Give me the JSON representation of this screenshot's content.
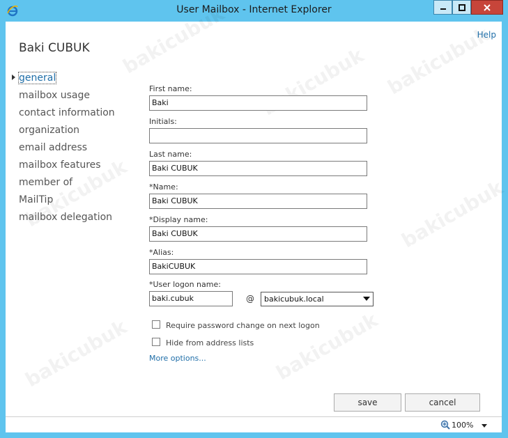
{
  "window": {
    "title": "User Mailbox - Internet Explorer",
    "minimize_icon": "minimize-icon",
    "maximize_icon": "maximize-icon",
    "close_icon": "close-icon"
  },
  "header": {
    "help": "Help",
    "user_name": "Baki CUBUK"
  },
  "nav": {
    "items": [
      {
        "label": "general",
        "active": true
      },
      {
        "label": "mailbox usage"
      },
      {
        "label": "contact information"
      },
      {
        "label": "organization"
      },
      {
        "label": "email address"
      },
      {
        "label": "mailbox features"
      },
      {
        "label": "member of"
      },
      {
        "label": "MailTip"
      },
      {
        "label": "mailbox delegation"
      }
    ]
  },
  "form": {
    "first_name": {
      "label": "First name:",
      "value": "Baki"
    },
    "initials": {
      "label": "Initials:",
      "value": ""
    },
    "last_name": {
      "label": "Last name:",
      "value": "Baki CUBUK"
    },
    "name": {
      "label": "*Name:",
      "value": "Baki CUBUK"
    },
    "display_name": {
      "label": "*Display name:",
      "value": "Baki CUBUK"
    },
    "alias": {
      "label": "*Alias:",
      "value": "BakiCUBUK"
    },
    "logon": {
      "label": "*User logon name:",
      "value": "baki.cubuk",
      "at": "@",
      "domain": "bakicubuk.local"
    },
    "require_pw_change": {
      "label": "Require password change on next logon",
      "checked": false
    },
    "hide_from_lists": {
      "label": "Hide from address lists",
      "checked": false
    },
    "more_options": "More options..."
  },
  "buttons": {
    "save": "save",
    "cancel": "cancel"
  },
  "statusbar": {
    "zoom": "100%"
  },
  "watermark": "bakicubuk"
}
